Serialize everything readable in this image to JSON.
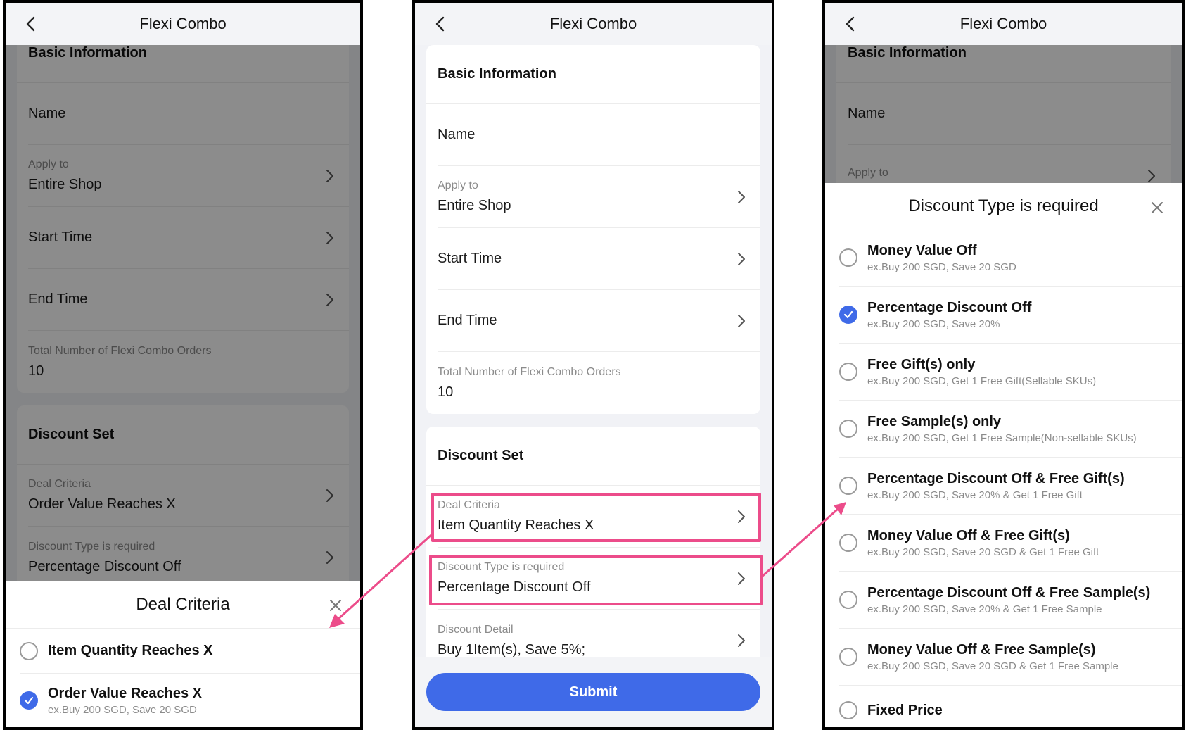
{
  "screen1": {
    "nav_title": "Flexi Combo",
    "basic_title": "Basic Information",
    "name_label": "Name",
    "apply_label": "Apply to",
    "apply_value": "Entire Shop",
    "start_label": "Start Time",
    "end_label": "End Time",
    "total_label": "Total Number of Flexi Combo Orders",
    "total_value": "10",
    "discount_title": "Discount Set",
    "deal_label": "Deal Criteria",
    "deal_value": "Order Value Reaches X",
    "type_label": "Discount Type is required",
    "type_value": "Percentage Discount Off",
    "sheet": {
      "title": "Deal Criteria",
      "options": [
        {
          "name": "Item Quantity Reaches X",
          "example": "",
          "selected": false
        },
        {
          "name": "Order Value Reaches X",
          "example": "ex.Buy 200 SGD, Save 20 SGD",
          "selected": true
        }
      ]
    }
  },
  "screen2": {
    "nav_title": "Flexi Combo",
    "basic_title": "Basic Information",
    "name_label": "Name",
    "apply_label": "Apply to",
    "apply_value": "Entire Shop",
    "start_label": "Start Time",
    "end_label": "End Time",
    "total_label": "Total Number of Flexi Combo Orders",
    "total_value": "10",
    "discount_title": "Discount Set",
    "deal_label": "Deal Criteria",
    "deal_value": "Item Quantity Reaches X",
    "type_label": "Discount Type is required",
    "type_value": "Percentage Discount Off",
    "detail_label": "Discount Detail",
    "detail_value": "Buy 1Item(s), Save 5%;",
    "submit_label": "Submit"
  },
  "screen3": {
    "nav_title": "Flexi Combo",
    "basic_title": "Basic Information",
    "name_label": "Name",
    "apply_label": "Apply to",
    "sheet": {
      "title": "Discount Type is required",
      "options": [
        {
          "name": "Money Value Off",
          "example": "ex.Buy 200 SGD, Save 20 SGD",
          "selected": false
        },
        {
          "name": "Percentage Discount Off",
          "example": "ex.Buy 200 SGD, Save 20%",
          "selected": true
        },
        {
          "name": "Free Gift(s) only",
          "example": "ex.Buy 200 SGD, Get 1 Free Gift(Sellable SKUs)",
          "selected": false
        },
        {
          "name": "Free Sample(s) only",
          "example": "ex.Buy 200 SGD, Get 1 Free Sample(Non-sellable SKUs)",
          "selected": false
        },
        {
          "name": "Percentage Discount Off & Free Gift(s)",
          "example": "ex.Buy 200 SGD, Save 20% & Get 1 Free Gift",
          "selected": false
        },
        {
          "name": "Money Value Off & Free Gift(s)",
          "example": "ex.Buy 200 SGD, Save 20 SGD & Get 1 Free Gift",
          "selected": false
        },
        {
          "name": "Percentage Discount Off & Free Sample(s)",
          "example": "ex.Buy 200 SGD, Save 20% & Get 1 Free Sample",
          "selected": false
        },
        {
          "name": "Money Value Off & Free Sample(s)",
          "example": "ex.Buy 200 SGD, Save 20 SGD & Get 1 Free Sample",
          "selected": false
        },
        {
          "name": "Fixed Price",
          "example": "",
          "selected": false
        }
      ]
    }
  },
  "colors": {
    "accent": "#3f6ae8",
    "highlight": "#ec4c8a",
    "overlay": "rgba(0,0,0,0.45)"
  }
}
